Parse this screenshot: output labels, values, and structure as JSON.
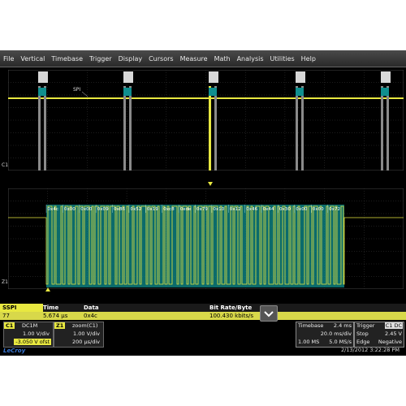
{
  "menu": [
    "File",
    "Vertical",
    "Timebase",
    "Trigger",
    "Display",
    "Cursors",
    "Measure",
    "Math",
    "Analysis",
    "Utilities",
    "Help"
  ],
  "waveform": {
    "top_label": "SPI",
    "channel_top": "C1",
    "channel_bottom": "Z1",
    "trace_color": "#e8e840",
    "decode_color": "#0f8f8f",
    "bytes": [
      "0x4c",
      "0x00",
      "0x00",
      "0x09",
      "0x86",
      "0x52",
      "0x19",
      "0xc8",
      "0xde",
      "0x79",
      "0x10",
      "0x12",
      "0x46",
      "0x44",
      "0x30",
      "0x00",
      "0x00",
      "0x72"
    ]
  },
  "decode_table": {
    "source": "SSPI",
    "row_index": "77",
    "columns": [
      "Time",
      "Data",
      "Bit Rate/Byte"
    ],
    "row": {
      "time": "5.674 µs",
      "data": "0x4c",
      "bitrate": "100.430 kbits/s"
    }
  },
  "channels": {
    "c1": {
      "tag": "C1",
      "coupling": "DC1M",
      "vdiv": "1.00 V/div",
      "offset": "-3.050 V ofst"
    },
    "z1": {
      "tag": "Z1",
      "name": "zoom(C1)",
      "vdiv": "1.00 V/div",
      "tdiv": "200 µs/div"
    }
  },
  "timebase": {
    "label": "Timebase",
    "delay": "2.4 ms",
    "per_div": "20.0 ms/div",
    "samples": "1.00 MS",
    "rate": "5.0 MS/s"
  },
  "trigger": {
    "label": "Trigger",
    "tag": "C1 DC",
    "mode": "Stop",
    "level": "2.45 V",
    "type": "Edge",
    "slope": "Negative"
  },
  "logo": "LeCroy",
  "timestamp": "2/13/2012 3:22:28 PM"
}
